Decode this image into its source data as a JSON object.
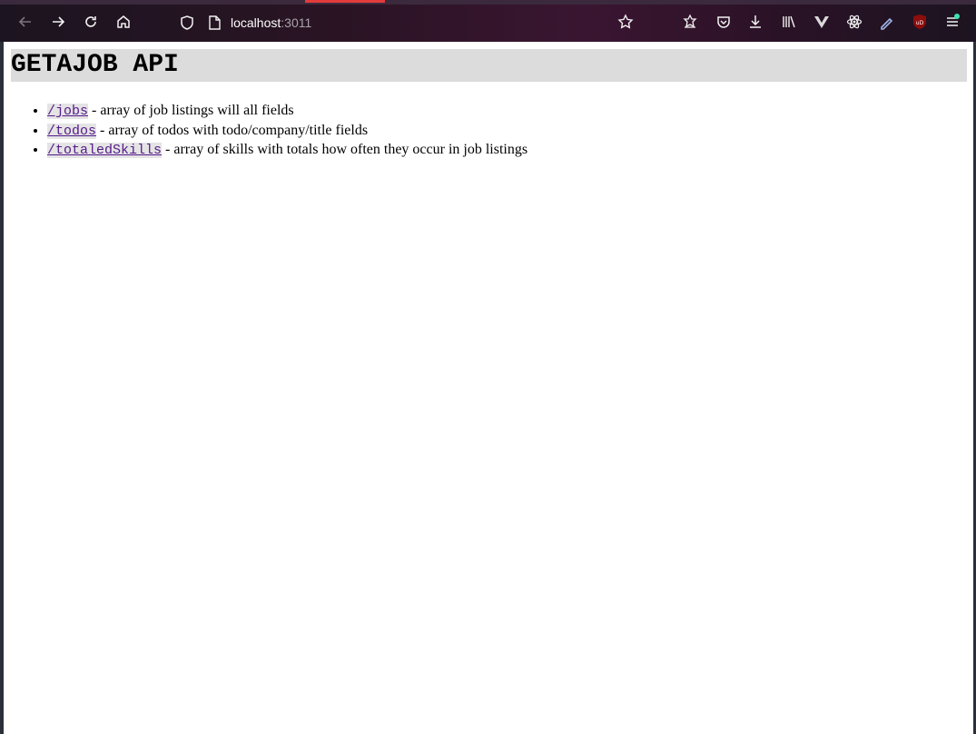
{
  "browser": {
    "url_host": "localhost",
    "url_port": ":3011",
    "icons": {
      "back": "back-arrow-icon",
      "forward": "forward-arrow-icon",
      "reload": "reload-icon",
      "home": "home-icon",
      "shield": "tracking-shield-icon",
      "page": "page-icon",
      "bookmark": "bookmark-star-icon",
      "extensions": [
        "pocket-save-icon",
        "pocket-icon",
        "download-icon",
        "library-icon",
        "vue-devtools-icon",
        "react-devtools-icon",
        "color-picker-icon",
        "ublock-icon",
        "menu-icon"
      ]
    },
    "colors": {
      "toolbar": "#2a1424",
      "tab_accent": "#e23b3b",
      "badge": "#3fe1b0"
    }
  },
  "page": {
    "title": "GETAJOB API",
    "endpoints": [
      {
        "path": "/jobs",
        "description": " - array of job listings will all fields"
      },
      {
        "path": "/todos",
        "description": " - array of todos with todo/company/title fields"
      },
      {
        "path": "/totaledSkills",
        "description": " - array of skills with totals how often they occur in job listings"
      }
    ]
  }
}
